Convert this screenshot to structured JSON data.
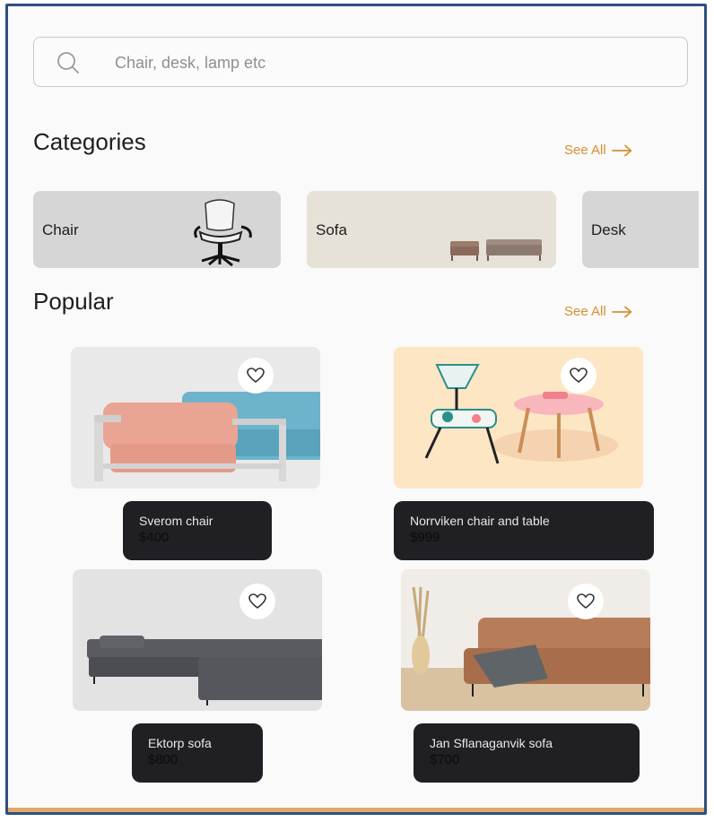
{
  "search": {
    "placeholder": "Chair, desk, lamp etc",
    "value": ""
  },
  "categories": {
    "title": "Categories",
    "see_all": "See All",
    "items": [
      {
        "label": "Chair"
      },
      {
        "label": "Sofa"
      },
      {
        "label": "Desk"
      }
    ]
  },
  "popular": {
    "title": "Popular",
    "see_all": "See All",
    "items": [
      {
        "name": "Sverom chair",
        "price": "$400"
      },
      {
        "name": "Norrviken chair and table",
        "price": "$999"
      },
      {
        "name": "Ektorp sofa",
        "price": "$800"
      },
      {
        "name": "Jan Sflanaganvik sofa",
        "price": "$700"
      }
    ]
  },
  "colors": {
    "accent": "#d4912e",
    "card_dark": "#1f1f24",
    "frame_border": "#2f4f7f",
    "bottom_strip": "#e0a86a"
  },
  "icons": {
    "search": "search-icon",
    "arrow": "arrow-right-icon",
    "favorite": "heart-icon"
  }
}
